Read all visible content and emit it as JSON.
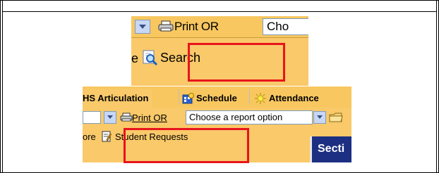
{
  "top_crop": {
    "print_label": "Print OR",
    "report_select_value": "Cho",
    "partial_text": "e",
    "search_label": "Search"
  },
  "bottom_crop": {
    "tabs": [
      {
        "label": "HS Articulation",
        "icon": "none"
      },
      {
        "label": "Schedule",
        "icon": "schedule-icon"
      },
      {
        "label": "Attendance",
        "icon": "attendance-icon"
      }
    ],
    "print_label": "Print OR",
    "report_select_value": "Choose a report option",
    "partial_text": "ore",
    "student_requests_label": "Student Requests",
    "section_label": "Secti"
  },
  "colors": {
    "toolbar_bg": "#f9c96a",
    "highlight": "#e8141d",
    "section_bg": "#1d2f82"
  }
}
